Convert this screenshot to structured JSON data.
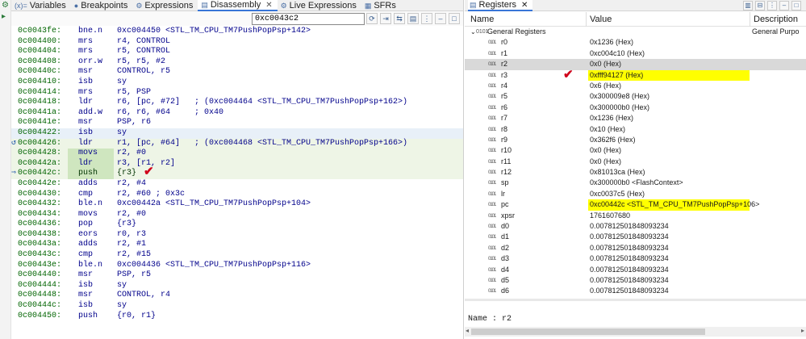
{
  "left_tabs": [
    {
      "label": "Variables",
      "icon": "(x)="
    },
    {
      "label": "Breakpoints",
      "icon": "●"
    },
    {
      "label": "Expressions",
      "icon": "⚙"
    },
    {
      "label": "Disassembly",
      "icon": "▤",
      "active": true,
      "close": "✕"
    },
    {
      "label": "Live Expressions",
      "icon": "⚙"
    },
    {
      "label": "SFRs",
      "icon": "▦"
    }
  ],
  "address_input": {
    "value": "0xc0043c2"
  },
  "disassembly": [
    {
      "addr": "0c0043fe:",
      "mn": "bne.n",
      "ops": "0xc004450 <STL_TM_CPU_TM7PushPopPsp+142>"
    },
    {
      "addr": "0c004400:",
      "mn": "mrs",
      "ops": "r4, CONTROL"
    },
    {
      "addr": "0c004404:",
      "mn": "mrs",
      "ops": "r5, CONTROL"
    },
    {
      "addr": "0c004408:",
      "mn": "orr.w",
      "ops": "r5, r5, #2"
    },
    {
      "addr": "0c00440c:",
      "mn": "msr",
      "ops": "CONTROL, r5"
    },
    {
      "addr": "0c004410:",
      "mn": "isb",
      "ops": "sy"
    },
    {
      "addr": "0c004414:",
      "mn": "mrs",
      "ops": "r5, PSP"
    },
    {
      "addr": "0c004418:",
      "mn": "ldr",
      "ops": "r6, [pc, #72]   ; (0xc004464 <STL_TM_CPU_TM7PushPopPsp+162>)"
    },
    {
      "addr": "0c00441a:",
      "mn": "add.w",
      "ops": "r6, r6, #64     ; 0x40"
    },
    {
      "addr": "0c00441e:",
      "mn": "msr",
      "ops": "PSP, r6"
    },
    {
      "addr": "0c004422:",
      "mn": "isb",
      "ops": "sy"
    },
    {
      "addr": "0c004426:",
      "mn": "ldr",
      "ops": "r1, [pc, #64]   ; (0xc004468 <STL_TM_CPU_TM7PushPopPsp+166>)"
    },
    {
      "addr": "0c004428:",
      "mn": "movs",
      "ops": "r2, #0"
    },
    {
      "addr": "0c00442a:",
      "mn": "ldr",
      "ops": "r3, [r1, r2]"
    },
    {
      "addr": "0c00442c:",
      "mn": "push",
      "ops": "{r3}"
    },
    {
      "addr": "0c00442e:",
      "mn": "adds",
      "ops": "r2, #4"
    },
    {
      "addr": "0c004430:",
      "mn": "cmp",
      "ops": "r2, #60 ; 0x3c"
    },
    {
      "addr": "0c004432:",
      "mn": "ble.n",
      "ops": "0xc00442a <STL_TM_CPU_TM7PushPopPsp+104>"
    },
    {
      "addr": "0c004434:",
      "mn": "movs",
      "ops": "r2, #0"
    },
    {
      "addr": "0c004436:",
      "mn": "pop",
      "ops": "{r3}"
    },
    {
      "addr": "0c004438:",
      "mn": "eors",
      "ops": "r0, r3"
    },
    {
      "addr": "0c00443a:",
      "mn": "adds",
      "ops": "r2, #1"
    },
    {
      "addr": "0c00443c:",
      "mn": "cmp",
      "ops": "r2, #15"
    },
    {
      "addr": "0c00443e:",
      "mn": "ble.n",
      "ops": "0xc004436 <STL_TM_CPU_TM7PushPopPsp+116>"
    },
    {
      "addr": "0c004440:",
      "mn": "msr",
      "ops": "PSP, r5"
    },
    {
      "addr": "0c004444:",
      "mn": "isb",
      "ops": "sy"
    },
    {
      "addr": "0c004448:",
      "mn": "msr",
      "ops": "CONTROL, r4"
    },
    {
      "addr": "0c00444c:",
      "mn": "isb",
      "ops": "sy"
    },
    {
      "addr": "0c004450:",
      "mn": "push",
      "ops": "{r0, r1}"
    }
  ],
  "registers_tab": {
    "label": "Registers",
    "icon": "▤",
    "close": "✕"
  },
  "columns": {
    "name": "Name",
    "value": "Value",
    "description": "Description"
  },
  "group": {
    "name": "General Registers",
    "description": "General Purpo",
    "expander": "⌄",
    "icon": "0101"
  },
  "registers": [
    {
      "name": "r0",
      "value": "0x1236 (Hex)"
    },
    {
      "name": "r1",
      "value": "0xc004c10 (Hex)"
    },
    {
      "name": "r2",
      "value": "0x0 (Hex)",
      "selected": true
    },
    {
      "name": "r3",
      "value": "0xfff94127 (Hex)",
      "highlight": true
    },
    {
      "name": "r4",
      "value": "0x6 (Hex)"
    },
    {
      "name": "r5",
      "value": "0x300009e8 (Hex)"
    },
    {
      "name": "r6",
      "value": "0x300000b0 (Hex)"
    },
    {
      "name": "r7",
      "value": "0x1236 (Hex)"
    },
    {
      "name": "r8",
      "value": "0x10 (Hex)"
    },
    {
      "name": "r9",
      "value": "0x362f6 (Hex)"
    },
    {
      "name": "r10",
      "value": "0x0 (Hex)"
    },
    {
      "name": "r11",
      "value": "0x0 (Hex)"
    },
    {
      "name": "r12",
      "value": "0x81013ca (Hex)"
    },
    {
      "name": "sp",
      "value": "0x300000b0 <FlashContext>"
    },
    {
      "name": "lr",
      "value": "0xc0037c5 (Hex)"
    },
    {
      "name": "pc",
      "value": "0xc00442c <STL_TM_CPU_TM7PushPopPsp+106>",
      "highlight": true
    },
    {
      "name": "xpsr",
      "value": "1761607680"
    },
    {
      "name": "d0",
      "value": "0.007812501848093234"
    },
    {
      "name": "d1",
      "value": "0.007812501848093234"
    },
    {
      "name": "d2",
      "value": "0.007812501848093234"
    },
    {
      "name": "d3",
      "value": "0.007812501848093234"
    },
    {
      "name": "d4",
      "value": "0.007812501848093234"
    },
    {
      "name": "d5",
      "value": "0.007812501848093234"
    },
    {
      "name": "d6",
      "value": "0.007812501848093234"
    }
  ],
  "detail": {
    "text": "Name : r2"
  },
  "colors": {
    "highlight": "#ffff00",
    "selected": "#d9d9d9",
    "check": "#d0021b",
    "address": "#006400",
    "instruction": "#00008b"
  }
}
